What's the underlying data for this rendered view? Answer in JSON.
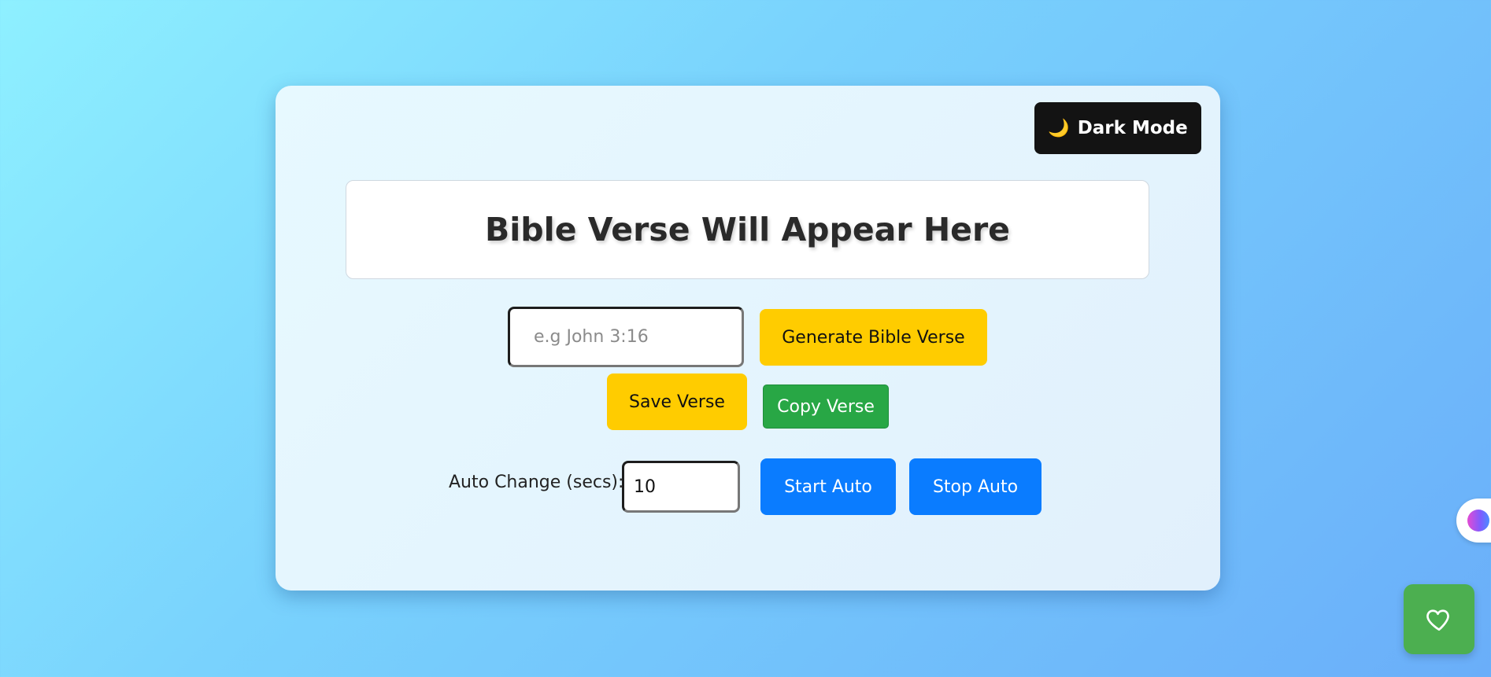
{
  "dark_mode": {
    "icon": "moon-icon",
    "label": "Dark Mode"
  },
  "verse": {
    "text": "Bible Verse Will Appear Here"
  },
  "search": {
    "placeholder": "e.g John 3:16",
    "value": ""
  },
  "buttons": {
    "generate": "Generate Bible Verse",
    "save": "Save Verse",
    "copy": "Copy Verse",
    "start_auto": "Start Auto",
    "stop_auto": "Stop Auto"
  },
  "auto": {
    "label": "Auto Change (secs):",
    "value": "10"
  },
  "extension": {
    "icon": "brain-icon"
  },
  "floating": {
    "icon": "heart-icon"
  },
  "colors": {
    "yellow": "#ffcc00",
    "green": "#28a745",
    "blue": "#0a7cff",
    "dark": "#131313"
  }
}
